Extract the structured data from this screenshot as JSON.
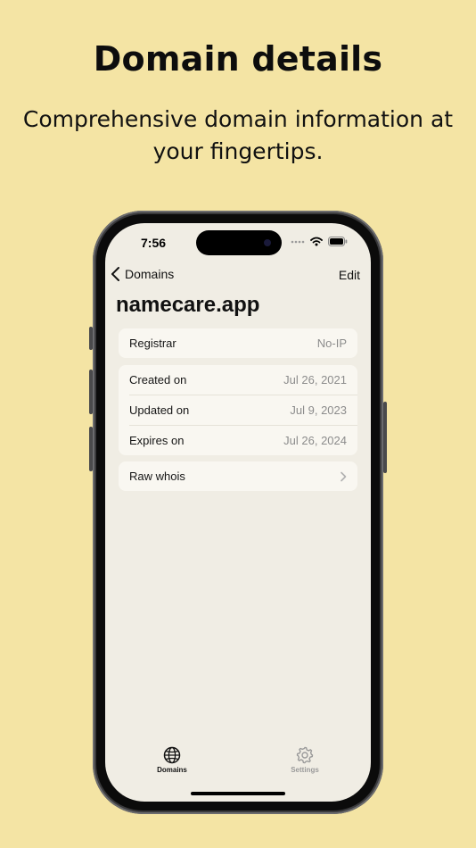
{
  "promo": {
    "headline": "Domain details",
    "subheadline": "Comprehensive domain information at your fingertips."
  },
  "status_bar": {
    "time": "7:56"
  },
  "nav": {
    "back_label": "Domains",
    "edit_label": "Edit"
  },
  "page": {
    "title": "namecare.app"
  },
  "registrar": {
    "label": "Registrar",
    "value": "No-IP"
  },
  "dates": [
    {
      "label": "Created on",
      "value": "Jul 26, 2021"
    },
    {
      "label": "Updated on",
      "value": "Jul 9, 2023"
    },
    {
      "label": "Expires on",
      "value": "Jul 26, 2024"
    }
  ],
  "raw_whois": {
    "label": "Raw whois",
    "icon": "chevron-right-icon"
  },
  "tabbar": {
    "tabs": [
      {
        "label": "Domains",
        "icon": "globe-icon",
        "active": true
      },
      {
        "label": "Settings",
        "icon": "gear-icon",
        "active": false
      }
    ]
  },
  "colors": {
    "background": "#f4e4a4",
    "screen": "#f0ede4",
    "card": "#f9f7f1",
    "secondary_text": "#8c8c8c",
    "inactive_tab": "#9a9a9a"
  }
}
